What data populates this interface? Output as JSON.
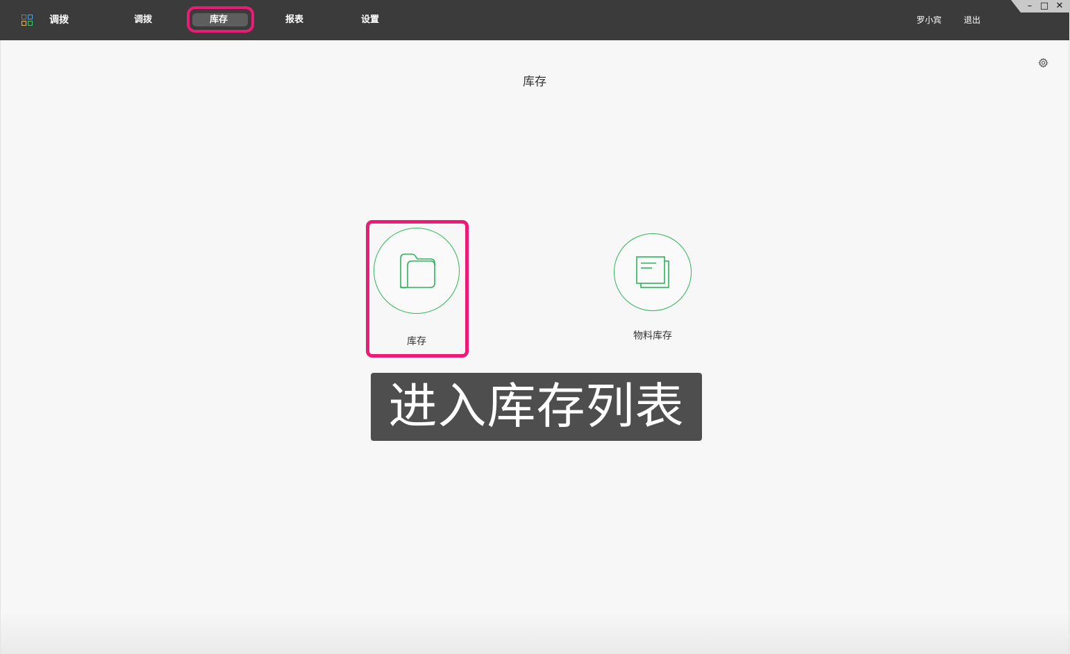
{
  "header": {
    "brand": "调拨",
    "nav": [
      "调拨",
      "库存",
      "报表",
      "设置"
    ],
    "active_nav": "库存",
    "user": "罗小宾",
    "logout": "退出",
    "window_controls": {
      "minimize": "–",
      "maximize": "□",
      "close": "✕"
    }
  },
  "page": {
    "title": "库存",
    "tiles": [
      {
        "label": "库存",
        "icon": "folder-icon"
      },
      {
        "label": "物料库存",
        "icon": "documents-icon"
      }
    ],
    "caption": "进入库存列表"
  },
  "colors": {
    "topbar": "#3b3b3b",
    "accent_green": "#2ab55a",
    "highlight_pink": "#ec1b76",
    "caption_bg": "#4e4e4e"
  }
}
